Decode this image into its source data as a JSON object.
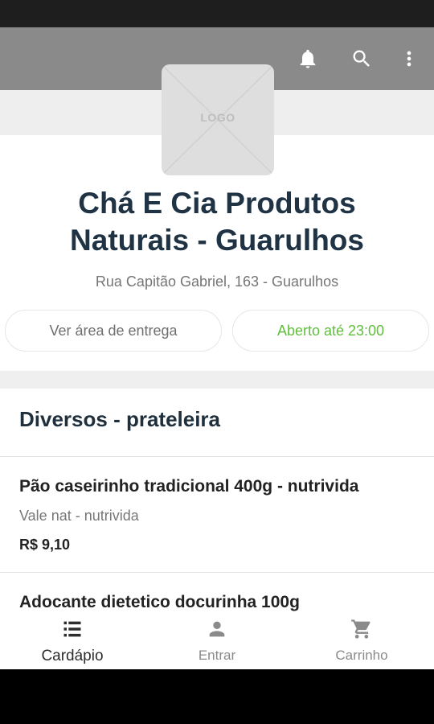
{
  "app": {
    "store_name": "Chá E Cia Produtos Naturais - Guarulhos",
    "address": "Rua Capitão Gabriel, 163 - Guarulhos",
    "logo_text": "LOGO",
    "delivery_button": "Ver área de entrega",
    "open_status": "Aberto até 23:00"
  },
  "section": {
    "title": "Diversos - prateleira"
  },
  "products": [
    {
      "name": "Pão caseirinho tradicional 400g - nutrivida",
      "description": "Vale nat - nutrivida",
      "price": "R$ 9,10"
    },
    {
      "name": "Adocante dietetico docurinha 100g"
    }
  ],
  "toolbar_icons": [
    "bell-icon",
    "search-icon",
    "more-vert-icon"
  ],
  "bottom_nav": [
    {
      "label": "Cardápio",
      "icon": "menu-list-icon",
      "active": true
    },
    {
      "label": "Entrar",
      "icon": "person-icon",
      "active": false
    },
    {
      "label": "Carrinho",
      "icon": "cart-icon",
      "active": false
    }
  ],
  "colors": {
    "appbar": "#8a8a8a",
    "title": "#1f3344",
    "open_status": "#5fbf3a"
  }
}
